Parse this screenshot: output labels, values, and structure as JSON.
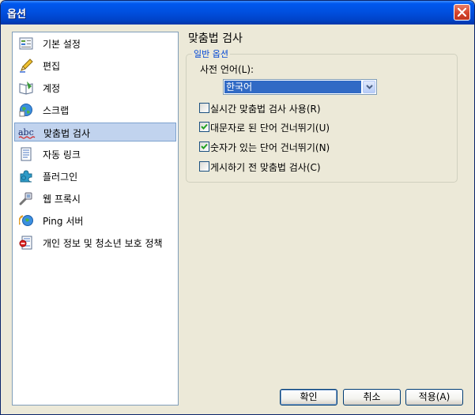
{
  "window": {
    "title": "옵션"
  },
  "nav": {
    "items": [
      {
        "label": "기본 설정",
        "icon": "settings-icon"
      },
      {
        "label": "편집",
        "icon": "pencil-icon"
      },
      {
        "label": "계정",
        "icon": "book-icon"
      },
      {
        "label": "스크랩",
        "icon": "globe-icon"
      },
      {
        "label": "맞춤법 검사",
        "icon": "spellcheck-icon",
        "selected": true
      },
      {
        "label": "자동 링크",
        "icon": "document-icon"
      },
      {
        "label": "플러그인",
        "icon": "puzzle-icon"
      },
      {
        "label": "웹 프록시",
        "icon": "proxy-icon"
      },
      {
        "label": "Ping 서버",
        "icon": "ping-icon"
      },
      {
        "label": "개인 정보 및 청소년 보호 정책",
        "icon": "privacy-icon"
      }
    ]
  },
  "panel": {
    "title": "맞춤법 검사",
    "group_label": "일반 옵션",
    "dictionary_label": "사전 언어(L):",
    "dictionary_value": "한국어",
    "options": [
      {
        "label": "실시간 맞춤법 검사 사용(R)",
        "checked": false
      },
      {
        "label": "대문자로 된 단어 건너뛰기(U)",
        "checked": true
      },
      {
        "label": "숫자가 있는 단어 건너뛰기(N)",
        "checked": true
      },
      {
        "label": "게시하기 전 맞춤법 검사(C)",
        "checked": false
      }
    ]
  },
  "buttons": {
    "ok": "확인",
    "cancel": "취소",
    "apply": "적용(A)"
  },
  "colors": {
    "titlebar": "#0054E3",
    "selection": "#316AC5",
    "group_label": "#0046D5"
  }
}
